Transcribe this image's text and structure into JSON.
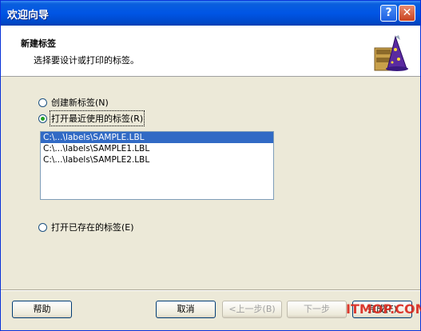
{
  "window": {
    "title": "欢迎向导",
    "help_button": "?",
    "close_button": "✕"
  },
  "header": {
    "title": "新建标签",
    "subtitle": "选择要设计或打印的标签。"
  },
  "options": {
    "new_label": "创建新标签(N)",
    "recent_label": "打开最近使用的标签(R)",
    "existing_label": "打开已存在的标签(E)",
    "selected": "recent_label"
  },
  "recent_files": [
    "C:\\...\\labels\\SAMPLE.LBL",
    "C:\\...\\labels\\SAMPLE1.LBL",
    "C:\\...\\labels\\SAMPLE2.LBL"
  ],
  "buttons": {
    "help": "帮助",
    "cancel": "取消",
    "back": "<上一步(B)",
    "next": "下一步",
    "finish": "完成(F)"
  },
  "watermark": "ITMOP.COM"
}
